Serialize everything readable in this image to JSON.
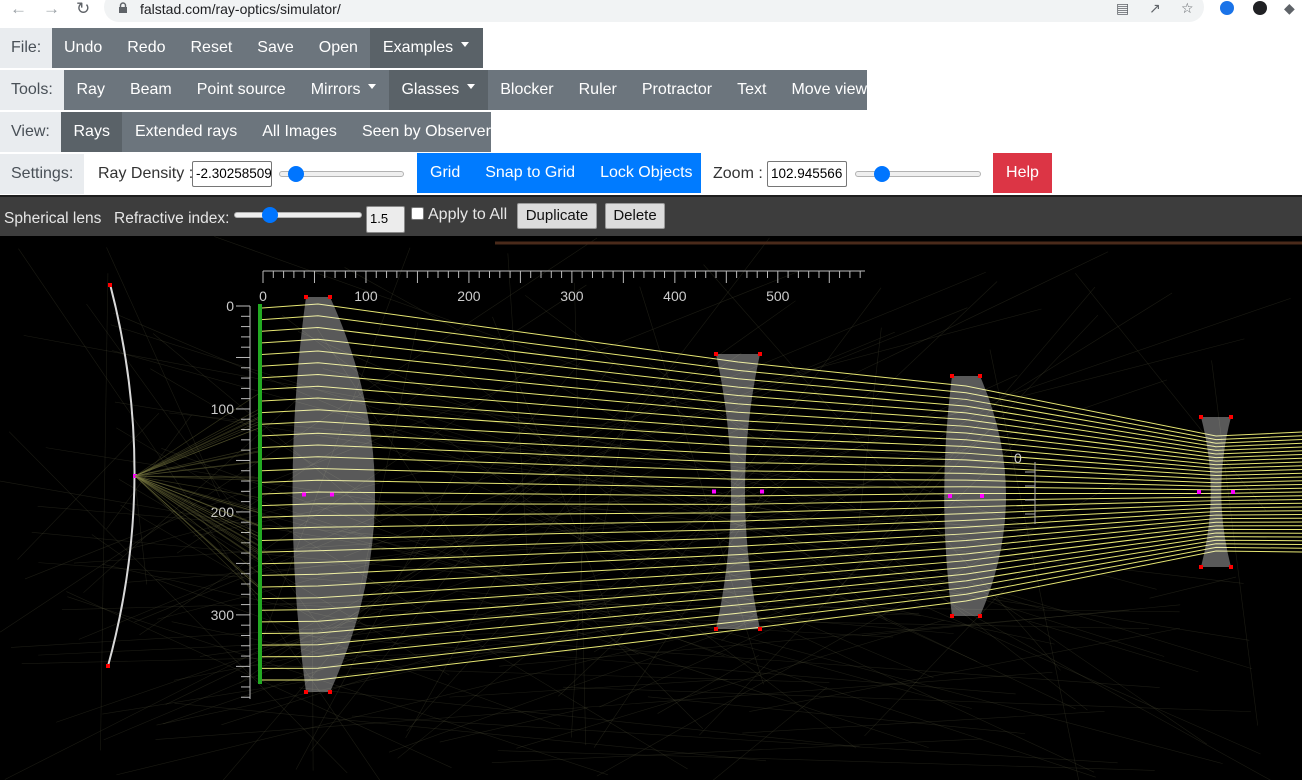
{
  "browser": {
    "url": "falstad.com/ray-optics/simulator/"
  },
  "file_bar": {
    "label": "File:",
    "items": [
      "Undo",
      "Redo",
      "Reset",
      "Save",
      "Open",
      "Examples"
    ]
  },
  "tools_bar": {
    "label": "Tools:",
    "items": [
      "Ray",
      "Beam",
      "Point source",
      "Mirrors",
      "Glasses",
      "Blocker",
      "Ruler",
      "Protractor",
      "Text",
      "Move view"
    ]
  },
  "view_bar": {
    "label": "View:",
    "items": [
      "Rays",
      "Extended rays",
      "All Images",
      "Seen by Observer"
    ],
    "selected": "Rays"
  },
  "settings_bar": {
    "label": "Settings:",
    "ray_density_label": "Ray Density :",
    "ray_density_value": "-2.3025850929940455",
    "ray_density_slider": 0.08,
    "grid": "Grid",
    "snap": "Snap to Grid",
    "lock": "Lock Objects",
    "zoom_label": "Zoom :",
    "zoom_value": "102.945566",
    "zoom_slider": 0.17,
    "help": "Help"
  },
  "object_bar": {
    "object_name": "Spherical lens",
    "refractive_label": "Refractive index:",
    "refractive_value": "1.5",
    "refractive_slider": 0.25,
    "apply_all": "Apply to All",
    "duplicate": "Duplicate",
    "delete": "Delete"
  },
  "ruler": {
    "h_labels": [
      "0",
      "100",
      "200",
      "300",
      "400",
      "500"
    ],
    "v_labels": [
      "0",
      "100",
      "200",
      "300"
    ],
    "protractor_label": "0"
  },
  "colors": {
    "toolbar_bg": "#6c757d",
    "toolbar_active": "#5a6268",
    "blue": "#007bff",
    "help": "#dc3545",
    "ray": "#ffff80",
    "beam_source": "#22aa22",
    "glass": "#7a7a7a",
    "handle": "#ff0000"
  }
}
